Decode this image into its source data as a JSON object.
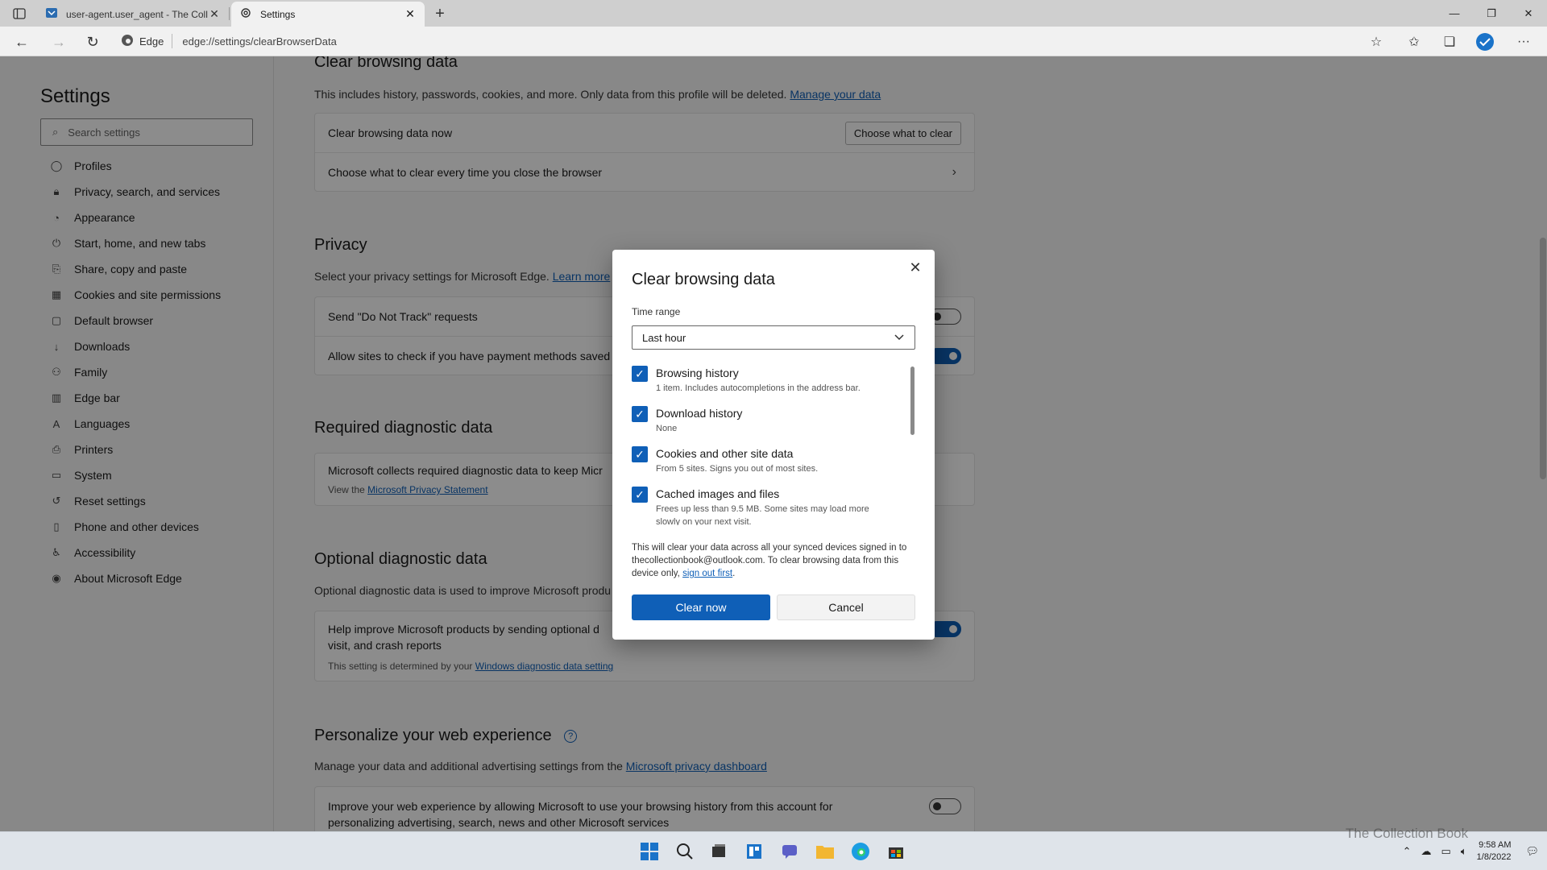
{
  "browser": {
    "tabs": [
      {
        "title": "user-agent.user_agent - The Coll",
        "active": false
      },
      {
        "title": "Settings",
        "active": true
      }
    ],
    "address_chip": "Edge",
    "url": "edge://settings/clearBrowserData"
  },
  "sidebar": {
    "title": "Settings",
    "search_placeholder": "Search settings",
    "items": [
      {
        "label": "Profiles",
        "icon": "profile-icon"
      },
      {
        "label": "Privacy, search, and services",
        "icon": "lock-icon"
      },
      {
        "label": "Appearance",
        "icon": "palette-icon"
      },
      {
        "label": "Start, home, and new tabs",
        "icon": "power-icon"
      },
      {
        "label": "Share, copy and paste",
        "icon": "share-icon"
      },
      {
        "label": "Cookies and site permissions",
        "icon": "cookie-icon"
      },
      {
        "label": "Default browser",
        "icon": "browser-icon"
      },
      {
        "label": "Downloads",
        "icon": "download-icon"
      },
      {
        "label": "Family",
        "icon": "family-icon"
      },
      {
        "label": "Edge bar",
        "icon": "edge-bar-icon"
      },
      {
        "label": "Languages",
        "icon": "language-icon"
      },
      {
        "label": "Printers",
        "icon": "printer-icon"
      },
      {
        "label": "System",
        "icon": "system-icon"
      },
      {
        "label": "Reset settings",
        "icon": "reset-icon"
      },
      {
        "label": "Phone and other devices",
        "icon": "phone-icon"
      },
      {
        "label": "Accessibility",
        "icon": "accessibility-icon"
      },
      {
        "label": "About Microsoft Edge",
        "icon": "edge-icon"
      }
    ]
  },
  "main": {
    "clear": {
      "title": "Clear browsing data",
      "desc": "This includes history, passwords, cookies, and more. Only data from this profile will be deleted.",
      "desc_link": "Manage your data",
      "row1": "Clear browsing data now",
      "row1_button": "Choose what to clear",
      "row2": "Choose what to clear every time you close the browser"
    },
    "privacy": {
      "title": "Privacy",
      "desc": "Select your privacy settings for Microsoft Edge.",
      "desc_link": "Learn more",
      "row1": "Send \"Do Not Track\" requests",
      "row2": "Allow sites to check if you have payment methods saved"
    },
    "required": {
      "title": "Required diagnostic data",
      "row": "Microsoft collects required diagnostic data to keep Micr",
      "sub": "View the",
      "sub_link": "Microsoft Privacy Statement"
    },
    "optional": {
      "title": "Optional diagnostic data",
      "desc": "Optional diagnostic data is used to improve Microsoft produ",
      "row_line1": "Help improve Microsoft products by sending optional d",
      "row_line2": "visit, and crash reports",
      "sub": "This setting is determined by your",
      "sub_link": "Windows diagnostic data setting"
    },
    "personalize": {
      "title": "Personalize your web experience",
      "desc": "Manage your data and additional advertising settings from the",
      "desc_link": "Microsoft privacy dashboard",
      "row_line1": "Improve your web experience by allowing Microsoft to use your browsing history from this account for",
      "row_line2": "personalizing advertising, search, news and other Microsoft services"
    }
  },
  "dialog": {
    "title": "Clear browsing data",
    "time_range_label": "Time range",
    "time_range_value": "Last hour",
    "options": [
      {
        "title": "Browsing history",
        "sub": "1 item. Includes autocompletions in the address bar.",
        "checked": true
      },
      {
        "title": "Download history",
        "sub": "None",
        "checked": true
      },
      {
        "title": "Cookies and other site data",
        "sub": "From 5 sites. Signs you out of most sites.",
        "checked": true
      },
      {
        "title": "Cached images and files",
        "sub": "Frees up less than 9.5 MB. Some sites may load more slowly on your next visit.",
        "checked": true
      }
    ],
    "note": "This will clear your data across all your synced devices signed in to thecollectionbook@outlook.com. To clear browsing data from this device only,",
    "note_link": "sign out first",
    "note_end": ".",
    "primary_button": "Clear now",
    "cancel_button": "Cancel"
  },
  "taskbar": {
    "time": "9:58 AM",
    "date": "1/8/2022",
    "watermark": "The Collection Book"
  },
  "colors": {
    "accent": "#0f5fb7",
    "overlay": "rgba(0,0,0,0.45)"
  }
}
